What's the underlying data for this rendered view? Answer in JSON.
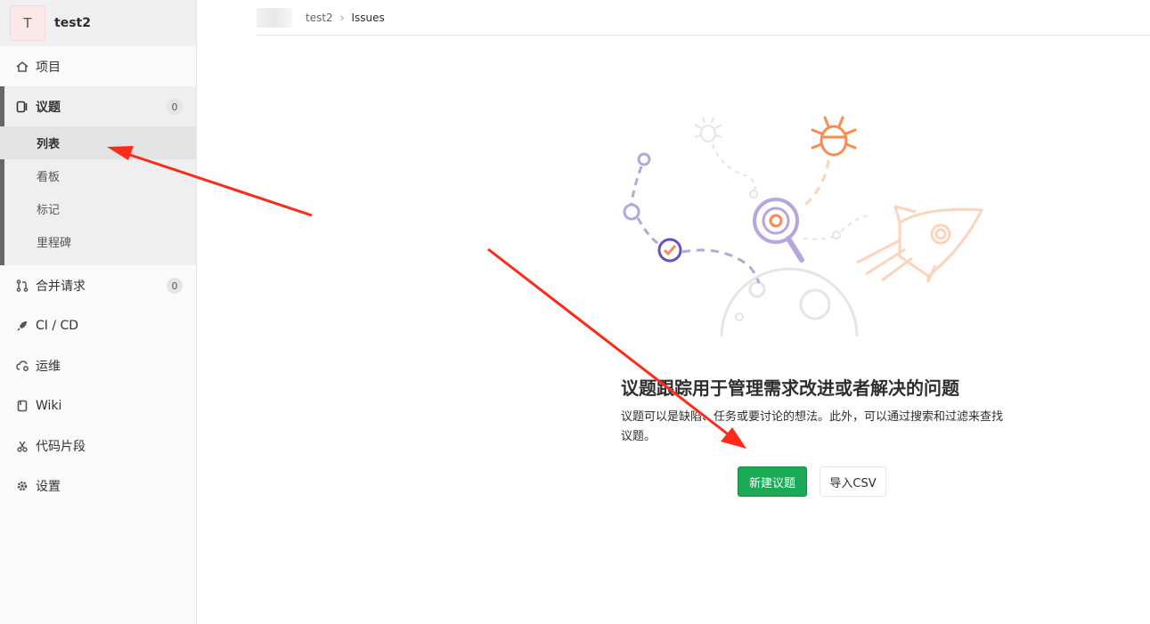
{
  "project": {
    "avatar_letter": "T",
    "name": "test2"
  },
  "sidebar": {
    "items": [
      {
        "label": "项目",
        "icon": "home-icon"
      },
      {
        "label": "议题",
        "icon": "issues-icon",
        "count": "0"
      },
      {
        "label": "合并请求",
        "icon": "merge-request-icon",
        "count": "0"
      },
      {
        "label": "CI / CD",
        "icon": "rocket-icon"
      },
      {
        "label": "运维",
        "icon": "cloud-gear-icon"
      },
      {
        "label": "Wiki",
        "icon": "book-icon"
      },
      {
        "label": "代码片段",
        "icon": "scissors-icon"
      },
      {
        "label": "设置",
        "icon": "gear-icon"
      }
    ],
    "issues_sub": [
      "列表",
      "看板",
      "标记",
      "里程碑"
    ]
  },
  "breadcrumb": {
    "parent": "test2",
    "current": "Issues"
  },
  "empty_state": {
    "title": "议题跟踪用于管理需求改进或者解决的问题",
    "description": "议题可以是缺陷、任务或要讨论的想法。此外，可以通过搜索和过滤来查找议题。",
    "new_button": "新建议题",
    "import_button": "导入CSV"
  },
  "colors": {
    "accent_green": "#1aaa55",
    "annotation_red": "#ff2a1a",
    "illustration_purple": "#6b4fbb",
    "illustration_orange": "#fc8a51"
  }
}
